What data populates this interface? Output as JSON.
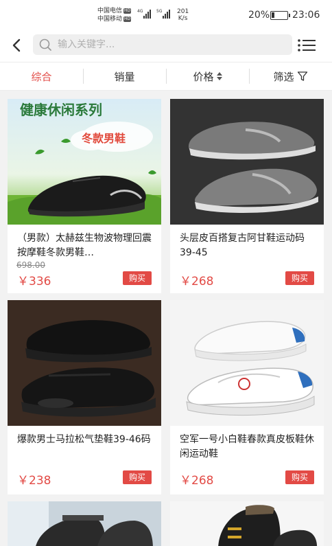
{
  "status_bar": {
    "carrier1": "中国电信",
    "carrier2": "中国移动",
    "hd": "HD",
    "net1": "4G",
    "net2": "5G",
    "speed_value": "201",
    "speed_unit": "K/s",
    "battery_percent": "20%",
    "battery_level": 0.2,
    "time": "23:06"
  },
  "search": {
    "placeholder": "输入关键字..."
  },
  "filters": {
    "tabs": [
      {
        "label": "综合",
        "active": true
      },
      {
        "label": "销量"
      },
      {
        "label": "价格"
      },
      {
        "label": "筛选"
      }
    ]
  },
  "products": [
    {
      "title": "（男款）太赫兹生物波物理回震按摩鞋冬款男鞋…",
      "original_price": "698.00",
      "price": "￥336",
      "buy": "购买",
      "image_caption_1": "健康休闲系列",
      "image_caption_2": "冬款男鞋"
    },
    {
      "title": "头层皮百搭复古阿甘鞋运动码39-45",
      "price": "￥268",
      "buy": "购买"
    },
    {
      "title": "爆款男士马拉松气垫鞋39-46码",
      "price": "￥238",
      "buy": "购买"
    },
    {
      "title": "空军一号小白鞋春款真皮板鞋休闲运动鞋",
      "price": "￥268",
      "buy": "购买"
    }
  ],
  "colors": {
    "accent": "#e24a45",
    "background": "#f2f2f2"
  }
}
